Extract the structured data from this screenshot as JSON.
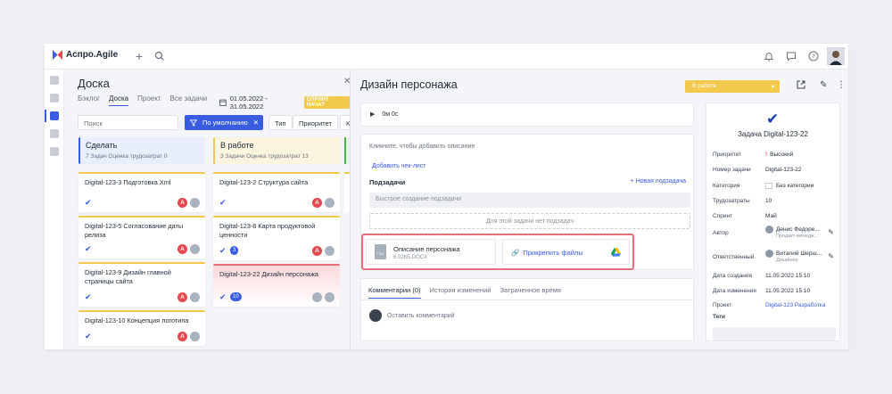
{
  "app": {
    "logo": "Аспро.Agile"
  },
  "board": {
    "title": "Доска",
    "tabs": [
      "Бэклог",
      "Доска",
      "Проект",
      "Все задачи"
    ],
    "date_range": "01.05.2022 - 31.05.2022",
    "sprint_badge": "СПРИНТ НАЧАТ",
    "search_placeholder": "Поиск",
    "filter_label": "По умолчанию",
    "type_label": "Тип",
    "priority_label": "Приоритет",
    "more_label": "К",
    "columns": [
      {
        "title": "Сделать",
        "meta": "7 Задач  Оценка трудозатрат 0",
        "color": "#e8eefc"
      },
      {
        "title": "В работе",
        "meta": "3 Задачи  Оценка трудозатрат 13",
        "color": "#fbf4df"
      }
    ],
    "cards_todo": [
      {
        "title": "Digital-123-3 Подготовка Xml"
      },
      {
        "title": "Digital-123-5 Согласование даты релиза"
      },
      {
        "title": "Digital-123-9 Дизайн главной страницы сайта"
      },
      {
        "title": "Digital-123-10 Концепция логотипа"
      }
    ],
    "cards_work": [
      {
        "title": "Digital-123-2 Структура сайта"
      },
      {
        "title": "Digital-123-8 Карта продуктовой ценности",
        "badge": "3"
      },
      {
        "title": "Digital-123-22 Дизайн персонажа",
        "badge": "10"
      }
    ]
  },
  "detail": {
    "title": "Дизайн персонажа",
    "status": "В работе",
    "timer": "0м 0с",
    "desc_placeholder": "Кликните, чтобы добавить описание",
    "add_checklist": "Добавить чек-лист",
    "subtasks_title": "Подзадачи",
    "new_subtask": "+ Новая подзадача",
    "quick_create": "Быстрое создание подзадачи",
    "no_subtasks": "Для этой задачи нет подзадач",
    "file_name": "Описание персонажа",
    "file_size": "6.02КБ.DOCX",
    "file_type": "FILE",
    "attach_label": "Прикрепить файлы",
    "comment_tabs": [
      "Комментарии (0)",
      "История изменений",
      "Затраченное время"
    ],
    "comment_placeholder": "Оставить комментарий"
  },
  "side": {
    "task_id": "Задача  Digital-123-22",
    "props": [
      {
        "label": "Приоритет",
        "value": "Высокий"
      },
      {
        "label": "Номер задачи",
        "value": "Digital-123-22"
      },
      {
        "label": "Категория",
        "value": "Без категории"
      },
      {
        "label": "Трудозатраты",
        "value": "10"
      },
      {
        "label": "Спринт",
        "value": "Май"
      },
      {
        "label": "Автор",
        "value": "Денис Федоре...",
        "sub": "Продакт-менедж..."
      },
      {
        "label": "Ответственный",
        "value": "Виталий Шерш...",
        "sub": "Дизайнер"
      },
      {
        "label": "Дата создания",
        "value": "11.05.2022 15:10"
      },
      {
        "label": "Дата изменения",
        "value": "11.05.2022 15:10"
      },
      {
        "label": "Проект",
        "value": "Digital-123 Разработка"
      }
    ],
    "tags_label": "Теги"
  },
  "colors": {
    "accent": "#3a5ce0",
    "status": "#f2c94c",
    "danger": "#e5484d"
  }
}
